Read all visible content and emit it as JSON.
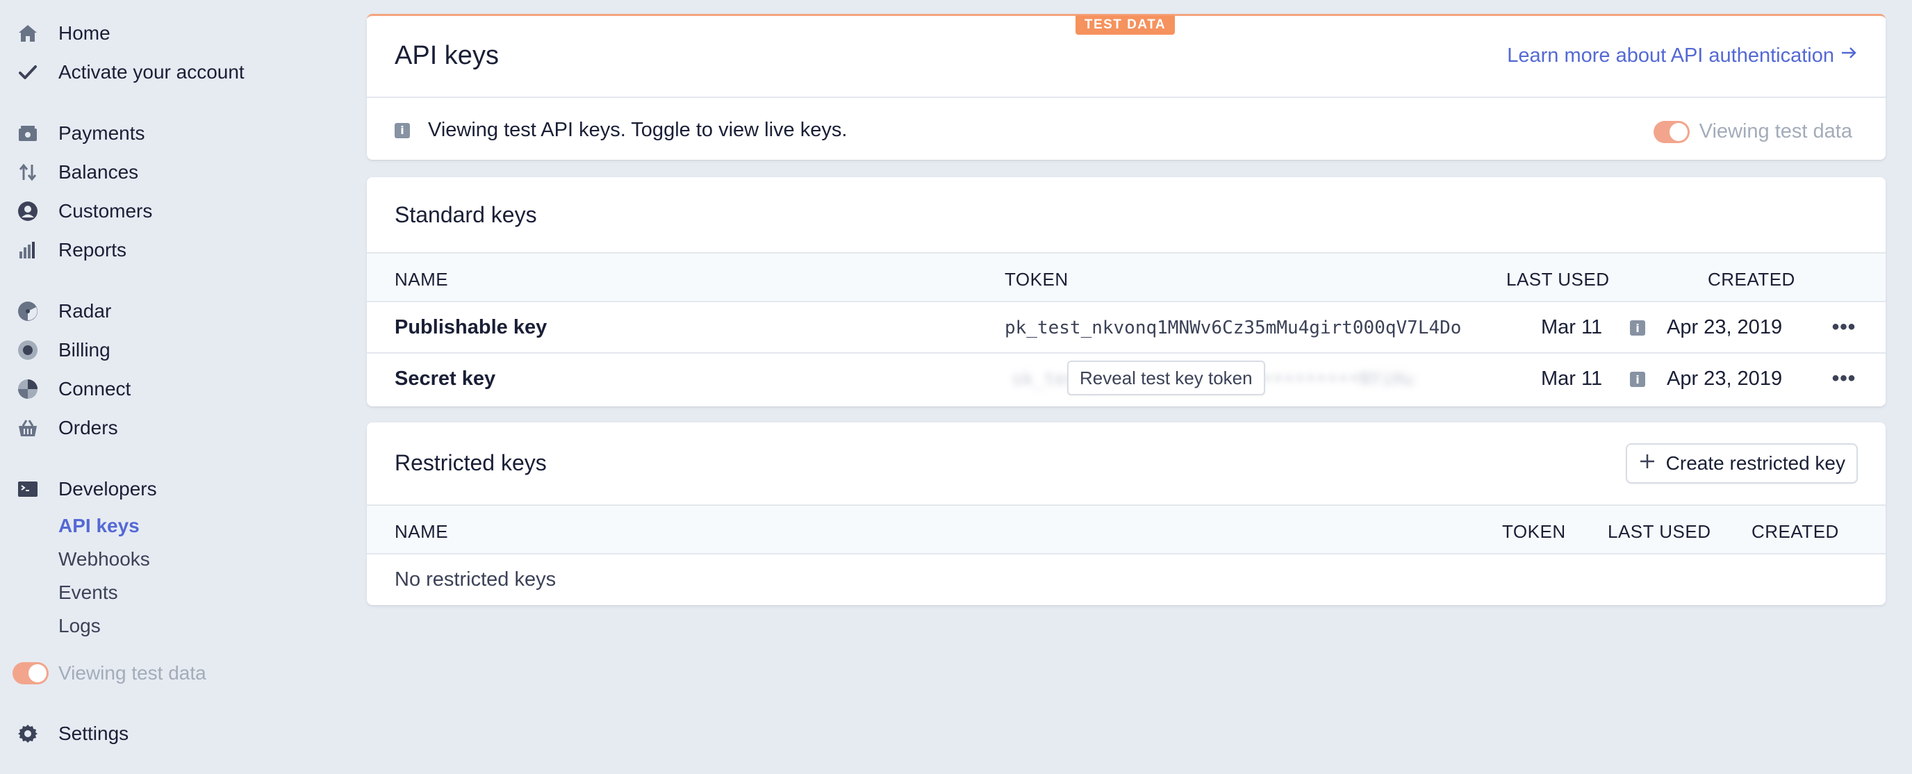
{
  "sidebar": {
    "nav": [
      {
        "label": "Home",
        "icon": "home-icon"
      },
      {
        "label": "Activate your account",
        "icon": "check-icon"
      },
      {
        "label": "Payments",
        "icon": "payments-icon"
      },
      {
        "label": "Balances",
        "icon": "balances-icon"
      },
      {
        "label": "Customers",
        "icon": "customers-icon"
      },
      {
        "label": "Reports",
        "icon": "reports-icon"
      },
      {
        "label": "Radar",
        "icon": "radar-icon"
      },
      {
        "label": "Billing",
        "icon": "billing-icon"
      },
      {
        "label": "Connect",
        "icon": "connect-icon"
      },
      {
        "label": "Orders",
        "icon": "orders-icon"
      },
      {
        "label": "Developers",
        "icon": "terminal-icon"
      }
    ],
    "developers_sub": [
      "API keys",
      "Webhooks",
      "Events",
      "Logs"
    ],
    "active_sub": "API keys",
    "test_toggle_label": "Viewing test data",
    "settings": {
      "label": "Settings",
      "icon": "gear-icon"
    }
  },
  "header_card": {
    "badge": "TEST DATA",
    "title": "API keys",
    "link": "Learn more about API authentication",
    "notice": "Viewing test API keys. Toggle to view live keys.",
    "toggle_label": "Viewing test data"
  },
  "standard_keys": {
    "title": "Standard keys",
    "columns": {
      "name": "NAME",
      "token": "TOKEN",
      "last_used": "LAST USED",
      "created": "CREATED"
    },
    "rows": [
      {
        "name": "Publishable key",
        "token": "pk_test_nkvonq1MNWv6Cz35mMu4girt000qV7L4Do",
        "last_used": "Mar 11",
        "created": "Apr 23, 2019"
      },
      {
        "name": "Secret key",
        "token": "sk_test_••••••••••••••••••••••••NYiHu",
        "reveal": "Reveal test key token",
        "last_used": "Mar 11",
        "created": "Apr 23, 2019"
      }
    ]
  },
  "restricted_keys": {
    "title": "Restricted keys",
    "create_button": "Create restricted key",
    "columns": {
      "name": "NAME",
      "token": "TOKEN",
      "last_used": "LAST USED",
      "created": "CREATED"
    },
    "empty": "No restricted keys"
  },
  "colors": {
    "accent": "#5469d4",
    "test_orange": "#f5925e",
    "toggle": "#f2a58c"
  }
}
